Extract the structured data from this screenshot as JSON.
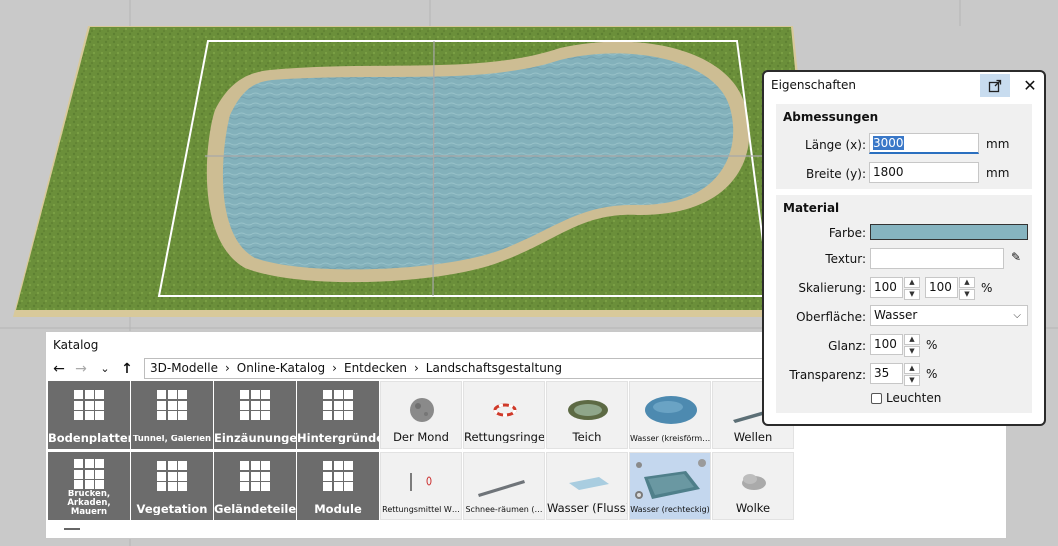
{
  "catalog": {
    "title": "Katalog",
    "nav": {
      "back": "←",
      "forward": "→",
      "dropdown": "⌄",
      "up": "↑"
    },
    "breadcrumb": [
      "3D-Modelle",
      "Online-Katalog",
      "Entdecken",
      "Landschaftsgestaltung"
    ],
    "breadcrumb_sep": "›",
    "categories_row1": [
      "Bodenplatten",
      "Tunnel, Galerien",
      "Einzäunungen",
      "Hintergründe"
    ],
    "categories_row2": [
      "Brücken, Arkaden, Mauern",
      "Vegetation",
      "Geländeteile",
      "Module"
    ],
    "items_row1": [
      "Der Mond",
      "Rettungsringe",
      "Teich",
      "Wasser (kreisförm…",
      "Wellen"
    ],
    "items_row2": [
      "Rettungsmittel W…",
      "Schnee-räumen (…",
      "Wasser (Fluss)",
      "Wasser (rechteckig)",
      "Wolke"
    ],
    "selected_item": "Wasser (rechteckig)"
  },
  "properties": {
    "title": "Eigenschaften",
    "dimensions": {
      "heading": "Abmessungen",
      "length_label": "Länge (x):",
      "length_value": "3000",
      "length_unit": "mm",
      "width_label": "Breite (y):",
      "width_value": "1800",
      "width_unit": "mm"
    },
    "material": {
      "heading": "Material",
      "color_label": "Farbe:",
      "color_value": "#86b4c0",
      "texture_label": "Textur:",
      "texture_value": "",
      "scale_label": "Skalierung:",
      "scale_x": "100",
      "scale_y": "100",
      "scale_unit": "%",
      "surface_label": "Oberfläche:",
      "surface_value": "Wasser",
      "gloss_label": "Glanz:",
      "gloss_value": "100",
      "gloss_unit": "%",
      "transparency_label": "Transparenz:",
      "transparency_value": "35",
      "transparency_unit": "%",
      "glow_label": "Leuchten",
      "glow_checked": false
    }
  },
  "colors": {
    "grass": "#6b8f3a",
    "water": "#7fb0bd",
    "sand": "#cdbd93",
    "viewport_bg": "#c9c9c9",
    "tile_dark": "#6c6c6c",
    "selected_tile": "#c4d7ee",
    "accent": "#2a6fbf"
  }
}
